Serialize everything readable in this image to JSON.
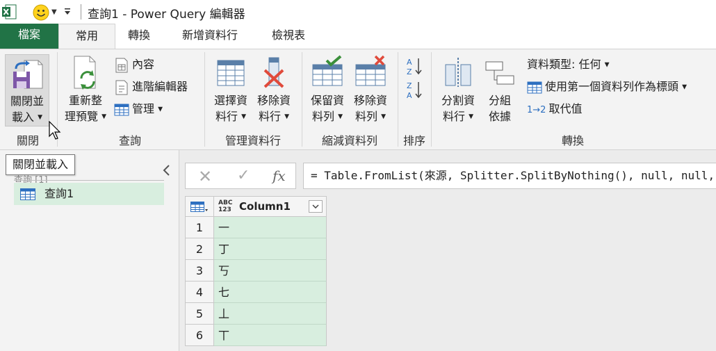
{
  "window": {
    "title": "查詢1 - Power Query 編輯器"
  },
  "tabs": [
    "檔案",
    "常用",
    "轉換",
    "新增資料行",
    "檢視表"
  ],
  "ribbon": {
    "close": {
      "btn_line1": "關閉並",
      "btn_line2": "載入",
      "group": "關閉"
    },
    "query": {
      "refresh_line1": "重新整",
      "refresh_line2": "理預覽",
      "properties": "內容",
      "advanced_editor": "進階編輯器",
      "manage": "管理",
      "group": "查詢"
    },
    "manage_columns": {
      "choose_line1": "選擇資",
      "choose_line2": "料行",
      "remove_line1": "移除資",
      "remove_line2": "料行",
      "group": "管理資料行"
    },
    "reduce_rows": {
      "keep_line1": "保留資",
      "keep_line2": "料列",
      "remove_line1": "移除資",
      "remove_line2": "料列",
      "group": "縮減資料列"
    },
    "sort": {
      "group": "排序",
      "asc": "A Z",
      "desc": "Z A"
    },
    "transform": {
      "split_line1": "分割資",
      "split_line2": "料行",
      "group_line1": "分組",
      "group_line2": "依據",
      "data_type": "資料類型: 任何",
      "first_row_header": "使用第一個資料列作為標頭",
      "replace_values": "取代值",
      "replace_icon_text": "1→2",
      "group": "轉換"
    }
  },
  "tooltip": "關閉並載入",
  "queries_pane": {
    "header": "查詢 [1]",
    "items": [
      "查詢1"
    ]
  },
  "formula_bar": {
    "fx": "fx",
    "formula": "= Table.FromList(來源, Splitter.SplitByNothing(), null, null, ExtraValues.Error)"
  },
  "grid": {
    "type_icon_line1": "ABC",
    "type_icon_line2": "123",
    "column": "Column1",
    "rows": [
      {
        "n": "1",
        "v": "一"
      },
      {
        "n": "2",
        "v": "丁"
      },
      {
        "n": "3",
        "v": "丂"
      },
      {
        "n": "4",
        "v": "七"
      },
      {
        "n": "5",
        "v": "丄"
      },
      {
        "n": "6",
        "v": "丅"
      }
    ]
  },
  "colors": {
    "accent": "#217346",
    "selection": "#d8eedf",
    "ribbon_bg": "#f3f3f3"
  }
}
